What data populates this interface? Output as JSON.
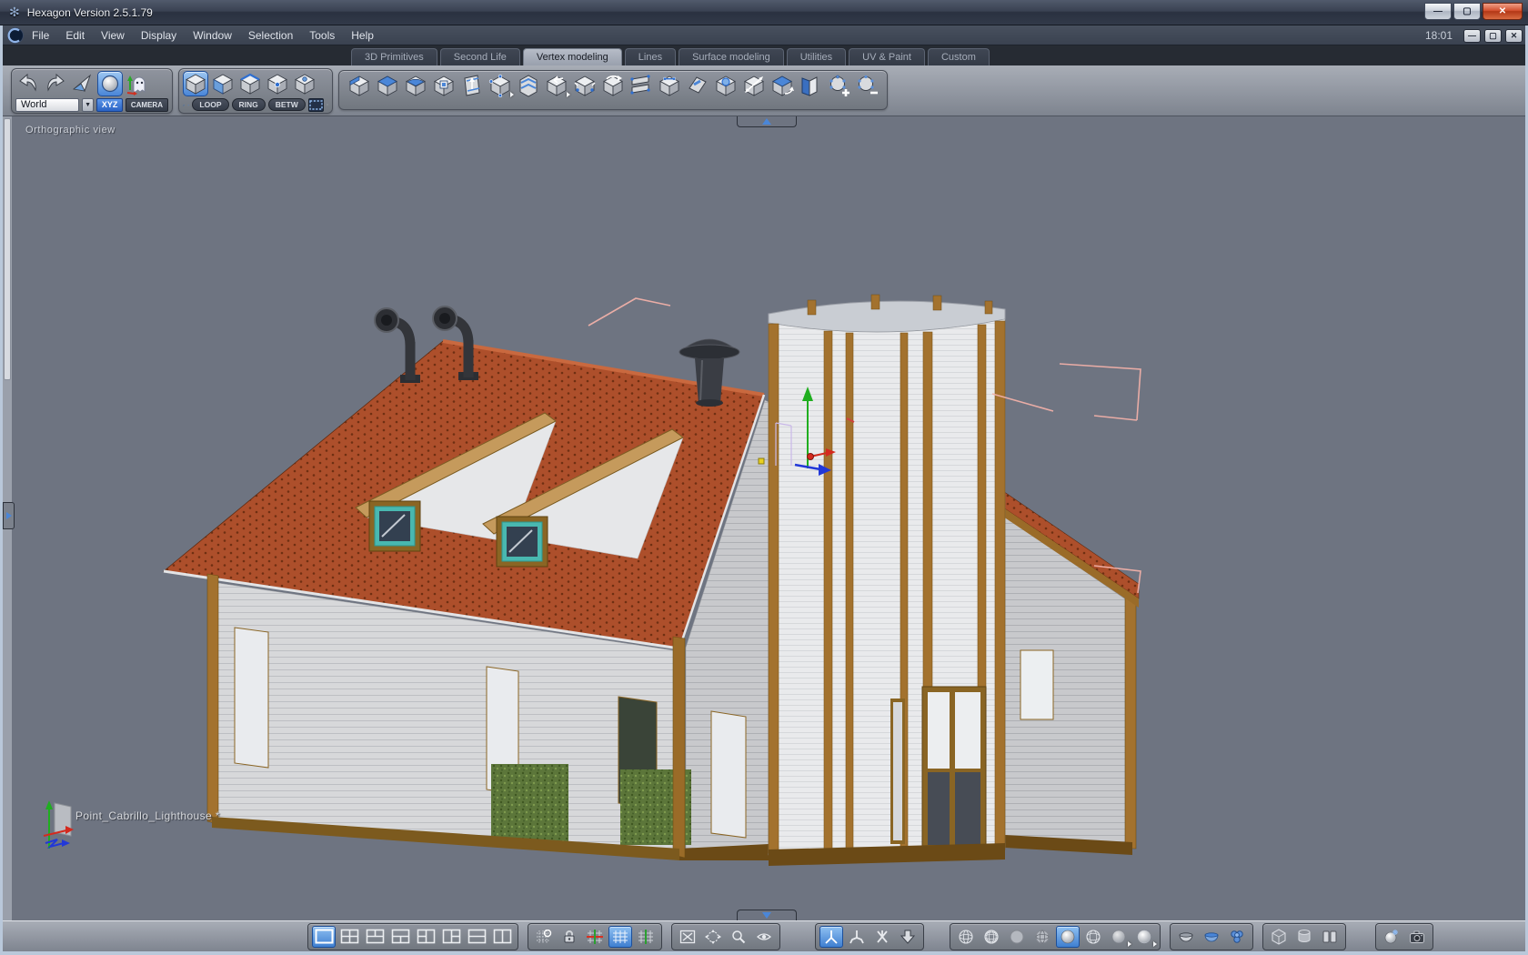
{
  "window": {
    "title": "Hexagon Version 2.5.1.79",
    "time": "18:01",
    "buttons": [
      "minimize-button",
      "maximize-button",
      "close-button"
    ]
  },
  "menu": {
    "items": [
      "File",
      "Edit",
      "View",
      "Display",
      "Window",
      "Selection",
      "Tools",
      "Help"
    ],
    "logo": "hexagon-logo-icon"
  },
  "tabs": {
    "items": [
      "3D Primitives",
      "Second Life",
      "Vertex modeling",
      "Lines",
      "Surface modeling",
      "Utilities",
      "UV & Paint",
      "Custom"
    ],
    "active_tab": "Vertex modeling"
  },
  "toolbar": {
    "world_selector": "World",
    "xyz_button": "XYZ",
    "camera_button": "CAMERA",
    "loop_button": "LOOP",
    "ring_button": "RING",
    "betw_button": "BETW",
    "history_tools": [
      "undo-arrow-icon",
      "redo-arrow-icon",
      "fly-select-icon",
      "sphere-select-icon",
      "ghost-icon"
    ],
    "selection_modes": [
      "object-mode-icon",
      "face-mode-icon",
      "edge-mode-icon",
      "vertex-mode-icon",
      "uv-point-mode-icon"
    ],
    "select_extras": [
      "pen-select-icon",
      "arrow-select-icon",
      "marquee-select-icon",
      "lasso-select-icon"
    ],
    "modeling_tools": [
      "bevel-icon",
      "extrude-top-icon",
      "smooth-cube-icon",
      "inset-hole-icon",
      "extrude-panel-icon",
      "tweak-vertices-icon",
      "fold-stripes-icon",
      "mirror-arrow-icon",
      "move-vertices-icon",
      "flip-normal-icon",
      "bridge-plates-icon",
      "connect-edges-icon",
      "fillet-corner-icon",
      "weld-patch-icon",
      "stretch-plane-icon",
      "sweep-cube-icon",
      "close-book-icon",
      "add-points-icon",
      "remove-points-icon"
    ]
  },
  "viewport": {
    "view_label": "Orthographic view",
    "status": "Point_Cabrillo_Lighthouse *",
    "model_name": "Point_Cabrillo_Lighthouse",
    "selection_color": "#f0b0a8",
    "background": "#6e7481"
  },
  "bottombar": {
    "layout_icons": [
      "layout-single-icon",
      "layout-quad-icon",
      "layout-top-split-icon",
      "layout-bottom-split-icon",
      "layout-left-split-icon",
      "layout-right-split-icon",
      "layout-hsplit-icon",
      "layout-vsplit-icon"
    ],
    "grid_icons": [
      "grid-lasso-icon",
      "lock-icon",
      "grid-axes-icon",
      "grid-active-icon",
      "grid-vline-icon"
    ],
    "nav_icons": [
      "fit-view-icon",
      "pan-icon",
      "zoom-icon",
      "eye-icon"
    ],
    "manipulator_icons": [
      "universal-manipulator-icon",
      "axis-manipulator-icon",
      "free-manipulator-icon",
      "drop-arrow-icon"
    ],
    "display_icons": [
      "wire-sphere-icon",
      "wire-sphere2-icon",
      "flat-sphere-icon",
      "textured-sphere-icon",
      "smooth-sphere-icon",
      "wire-sphere3-icon",
      "soft-sphere-icon",
      "bright-sphere-icon"
    ],
    "shading_icons": [
      "bowl-icon",
      "blue-bowl-icon",
      "sphere-cluster-icon"
    ],
    "object-icons": [
      "wire-cube-icon",
      "cylinder-icon",
      "panels-icon"
    ],
    "render_icons": [
      "render-sphere-icon",
      "camera-icon"
    ]
  },
  "colors": {
    "accent_blue": "#4a86d8",
    "roof": "#ad4f2b",
    "trim_brown": "#a3722e",
    "gizmo_green": "#1fae1f",
    "gizmo_red": "#d42a1e",
    "gizmo_blue": "#2238d8"
  }
}
